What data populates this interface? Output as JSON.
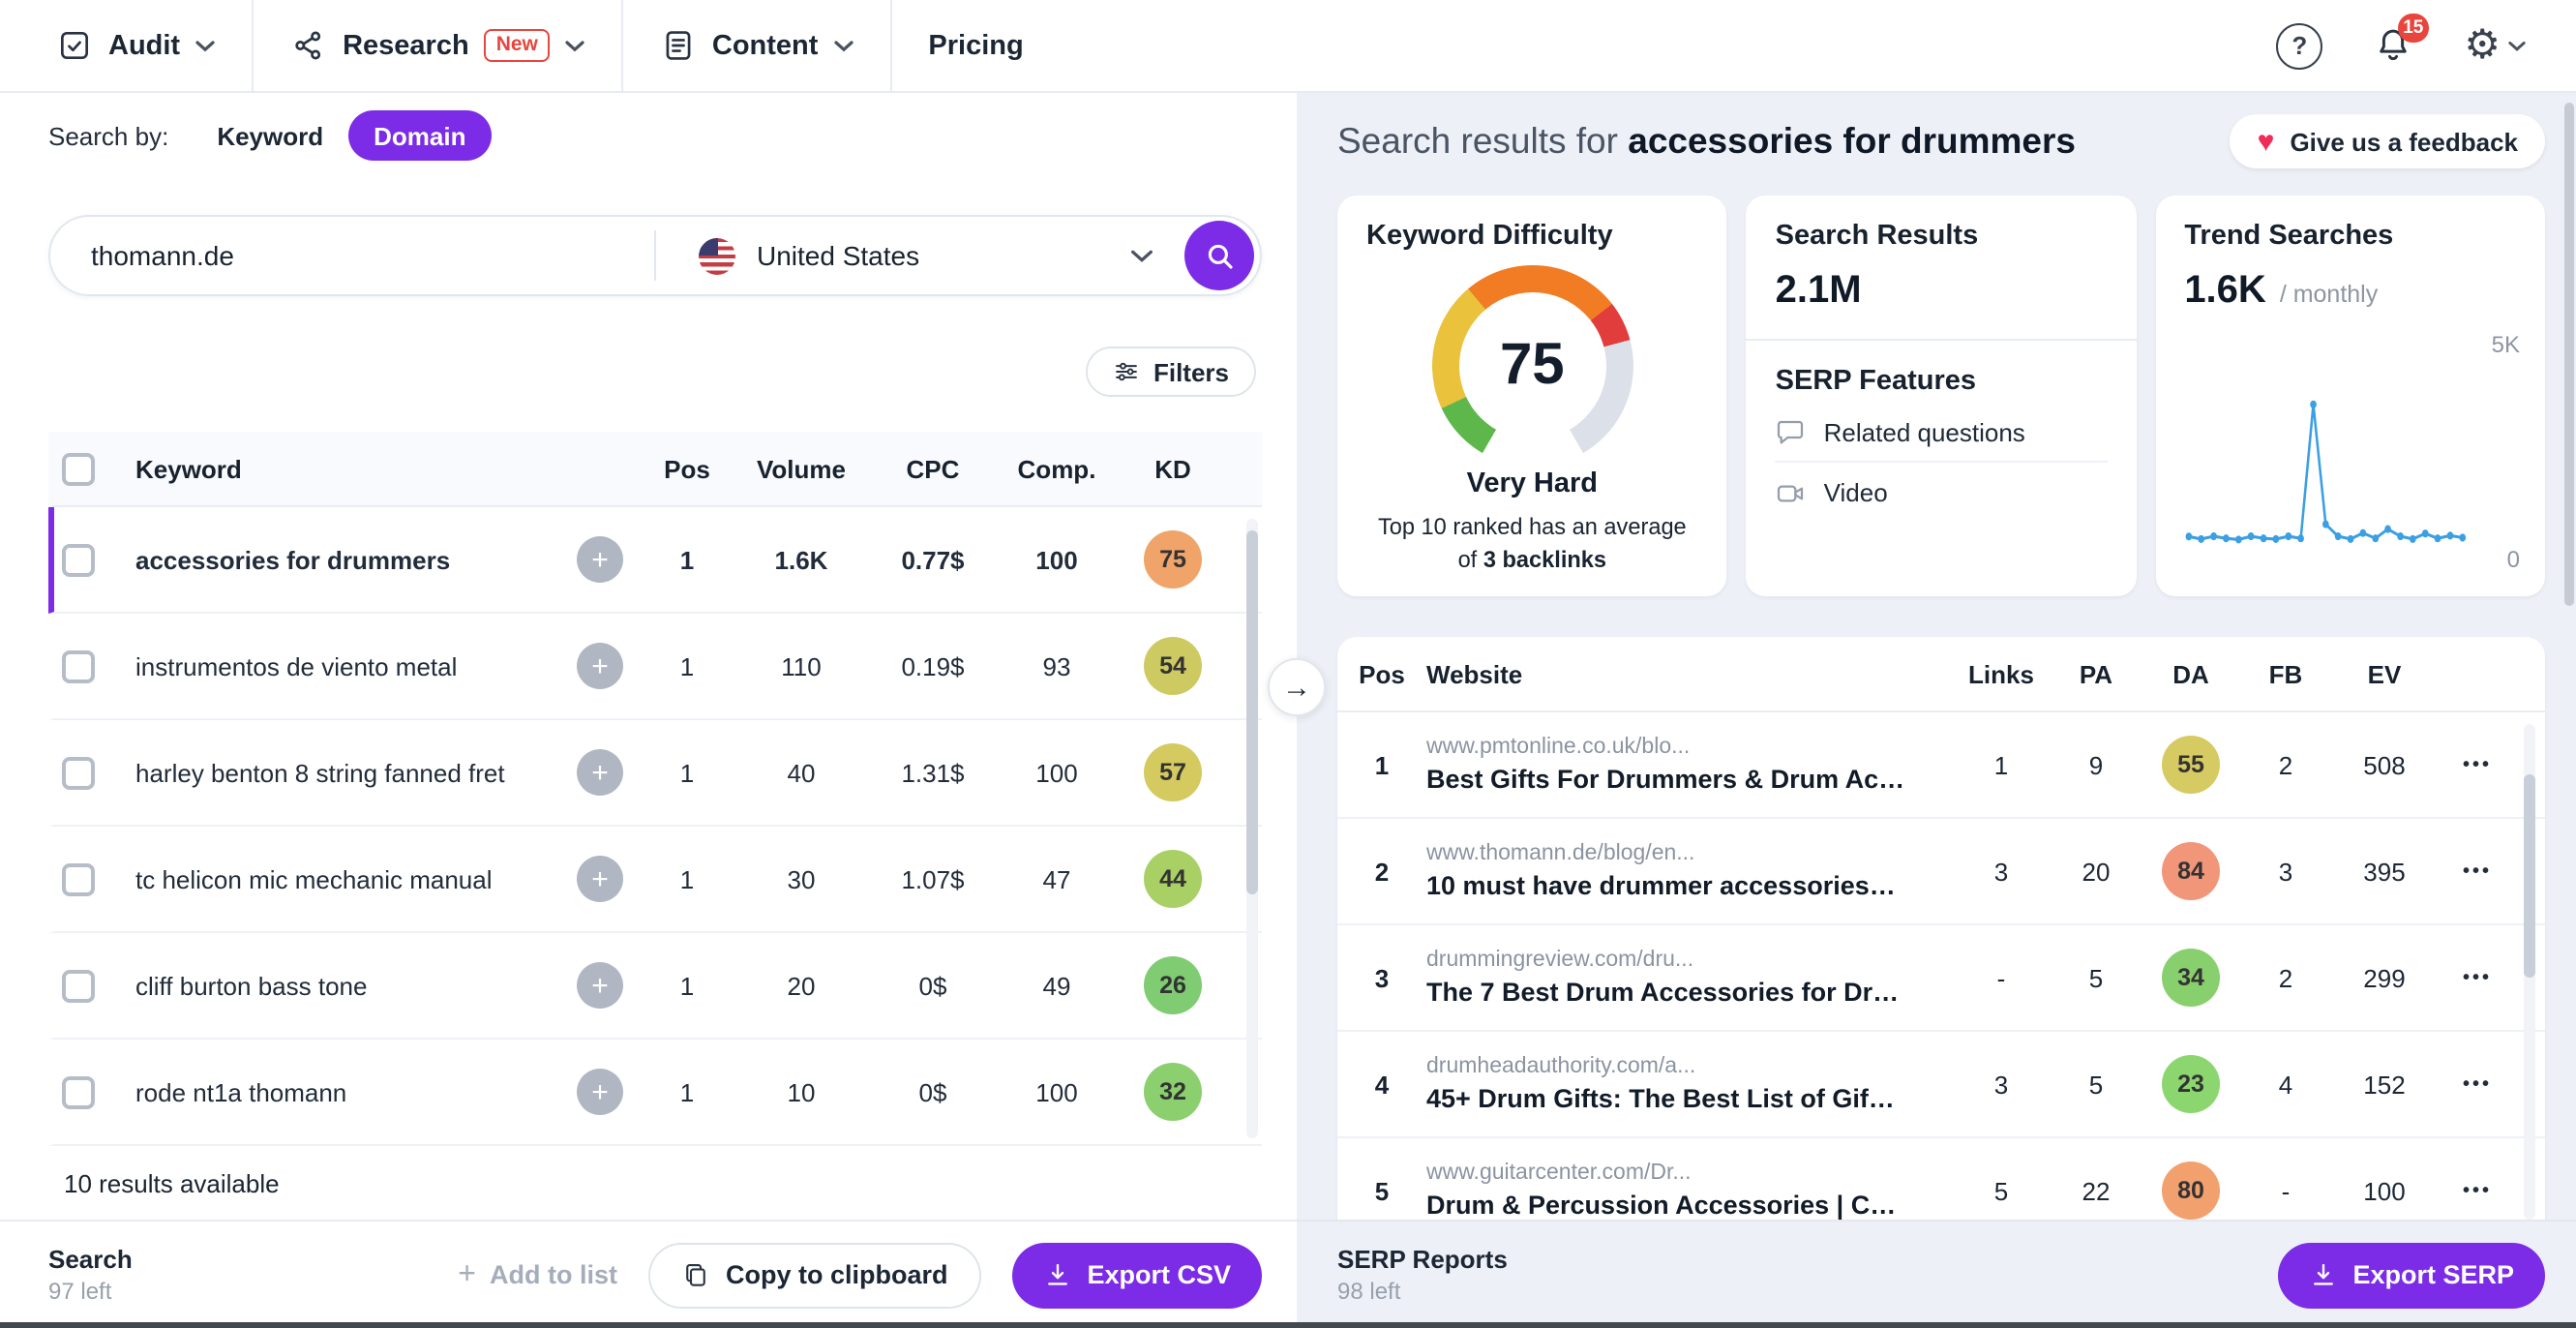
{
  "theme": {
    "accent": "#7c2ce6",
    "danger": "#e8453c"
  },
  "icons": {
    "help": "?",
    "gear": "⚙",
    "heart": "♥",
    "arrow_right": "→",
    "plus": "+",
    "dots": "•••"
  },
  "nav": {
    "audit": "Audit",
    "research": "Research",
    "research_badge": "New",
    "content": "Content",
    "pricing": "Pricing",
    "notifications": "15"
  },
  "left": {
    "search_by": "Search by:",
    "mode_keyword": "Keyword",
    "mode_domain": "Domain",
    "query": "thomann.de",
    "country": "United States",
    "filters": "Filters",
    "cols": {
      "keyword": "Keyword",
      "pos": "Pos",
      "volume": "Volume",
      "cpc": "CPC",
      "comp": "Comp.",
      "kd": "KD"
    },
    "rows": [
      {
        "keyword": "accessories for drummers",
        "pos": "1",
        "volume": "1.6K",
        "cpc": "0.77$",
        "comp": "100",
        "kd": "75",
        "kd_color": "#f0a469"
      },
      {
        "keyword": "instrumentos de viento metal",
        "pos": "1",
        "volume": "110",
        "cpc": "0.19$",
        "comp": "93",
        "kd": "54",
        "kd_color": "#cdca62"
      },
      {
        "keyword": "harley benton 8 string fanned fret",
        "pos": "1",
        "volume": "40",
        "cpc": "1.31$",
        "comp": "100",
        "kd": "57",
        "kd_color": "#d4ca5f"
      },
      {
        "keyword": "tc helicon mic mechanic manual",
        "pos": "1",
        "volume": "30",
        "cpc": "1.07$",
        "comp": "47",
        "kd": "44",
        "kd_color": "#a9d065"
      },
      {
        "keyword": "cliff burton bass tone",
        "pos": "1",
        "volume": "20",
        "cpc": "0$",
        "comp": "49",
        "kd": "26",
        "kd_color": "#7fcc72"
      },
      {
        "keyword": "rode nt1a thomann",
        "pos": "1",
        "volume": "10",
        "cpc": "0$",
        "comp": "100",
        "kd": "32",
        "kd_color": "#8bcf6e"
      }
    ],
    "note": "10 results available",
    "footer": {
      "label": "Search",
      "remaining": "97 left",
      "add": "Add to list",
      "copy": "Copy to clipboard",
      "export": "Export CSV"
    }
  },
  "right": {
    "title_prefix": "Search results for ",
    "title_keyword": "accessories for drummers",
    "feedback": "Give us a feedback",
    "difficulty": {
      "title": "Keyword Difficulty",
      "score": "75",
      "level": "Very Hard",
      "note_prefix": "Top 10 ranked has an average of ",
      "note_bold": "3 backlinks",
      "colors": {
        "green": "#5eb74a",
        "yellow": "#eac23c",
        "orange": "#f17c24",
        "red": "#e23d3d",
        "track": "#dce1e9"
      }
    },
    "results": {
      "title": "Search Results",
      "value": "2.1M",
      "serp_title": "SERP Features",
      "feature_questions": "Related questions",
      "feature_video": "Video"
    },
    "trend": {
      "title": "Trend Searches",
      "value": "1.6K",
      "suffix": "/ monthly",
      "y_max": "5K",
      "y_min": "0",
      "color": "#3b9fe3",
      "points": [
        550,
        480,
        560,
        500,
        470,
        560,
        500,
        480,
        560,
        500,
        4300,
        900,
        560,
        480,
        650,
        500,
        760,
        560,
        480,
        640,
        500,
        580,
        520
      ]
    },
    "serp_cols": {
      "pos": "Pos",
      "website": "Website",
      "links": "Links",
      "pa": "PA",
      "da": "DA",
      "fb": "FB",
      "ev": "EV"
    },
    "serp_rows": [
      {
        "pos": "1",
        "url": "www.pmtonline.co.uk/blo...",
        "title": "Best Gifts For Drummers & Drum Ac…",
        "links": "1",
        "pa": "9",
        "da": "55",
        "da_color": "#d6ca62",
        "fb": "2",
        "ev": "508"
      },
      {
        "pos": "2",
        "url": "www.thomann.de/blog/en...",
        "title": "10 must have drummer accessories…",
        "links": "3",
        "pa": "20",
        "da": "84",
        "da_color": "#f29679",
        "fb": "3",
        "ev": "395"
      },
      {
        "pos": "3",
        "url": "drummingreview.com/dru...",
        "title": "The 7 Best Drum Accessories for Dr…",
        "links": "-",
        "pa": "5",
        "da": "34",
        "da_color": "#88cf6d",
        "fb": "2",
        "ev": "299"
      },
      {
        "pos": "4",
        "url": "drumheadauthority.com/a...",
        "title": "45+ Drum Gifts: The Best List of Gif…",
        "links": "3",
        "pa": "5",
        "da": "23",
        "da_color": "#8cd66f",
        "fb": "4",
        "ev": "152"
      },
      {
        "pos": "5",
        "url": "www.guitarcenter.com/Dr...",
        "title": "Drum & Percussion Accessories | C…",
        "links": "5",
        "pa": "22",
        "da": "80",
        "da_color": "#f2a06e",
        "fb": "-",
        "ev": "100"
      }
    ],
    "footer": {
      "label": "SERP Reports",
      "remaining": "98 left",
      "export": "Export SERP"
    }
  },
  "chart_data": [
    {
      "type": "gauge",
      "title": "Keyword Difficulty",
      "value": 75,
      "min": 0,
      "max": 100,
      "label": "Very Hard",
      "segments": [
        "green",
        "yellow",
        "orange",
        "red",
        "track"
      ]
    },
    {
      "type": "line",
      "title": "Trend Searches",
      "ylabel": "monthly searches",
      "ylim": [
        0,
        5000
      ],
      "legend": "none",
      "values": [
        550,
        480,
        560,
        500,
        470,
        560,
        500,
        480,
        560,
        500,
        4300,
        900,
        560,
        480,
        650,
        500,
        760,
        560,
        480,
        640,
        500,
        580,
        520
      ]
    }
  ]
}
